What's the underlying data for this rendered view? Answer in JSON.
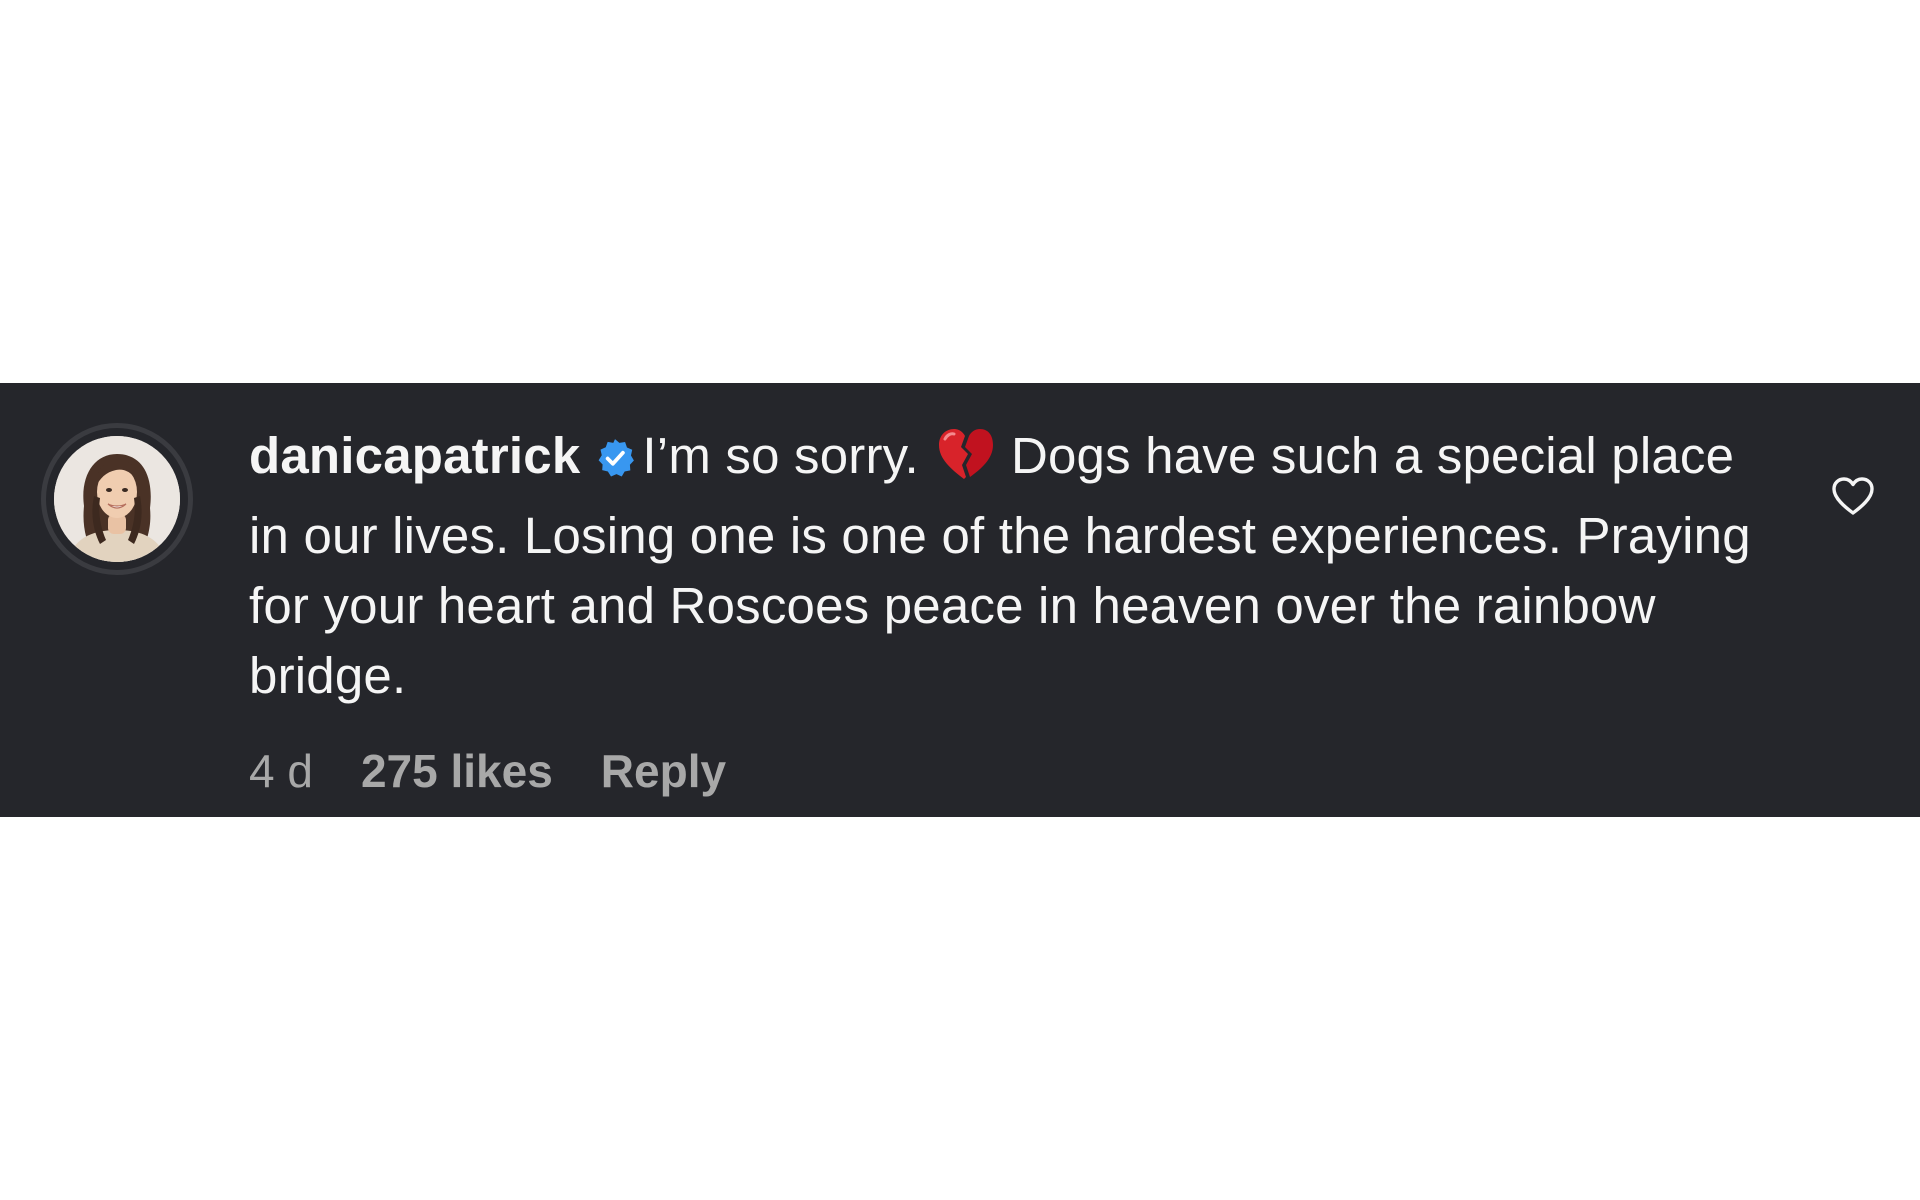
{
  "comment": {
    "username": "danicapatrick",
    "verified": true,
    "text_before_emoji": "I’m so sorry.",
    "emoji": "broken-heart",
    "text_after_emoji": "Dogs have such a special place in our lives. Losing one is one of the hardest experiences. Praying for your heart and Roscoes peace in heaven over the rainbow bridge.",
    "time_ago": "4 d",
    "likes": "275 likes",
    "reply_label": "Reply"
  },
  "icons": {
    "avatar": "profile-photo",
    "verified": "verified-badge-icon",
    "like": "heart-outline-icon"
  },
  "colors": {
    "band_background": "#25262b",
    "text_primary": "#f5f5f5",
    "text_secondary": "#a8a8a8",
    "verified_blue": "#3897f0"
  }
}
